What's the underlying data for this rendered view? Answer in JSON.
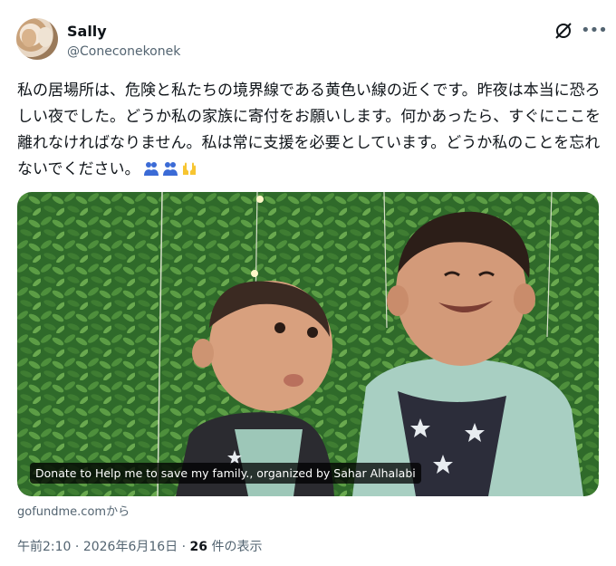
{
  "author": {
    "name": "Sally",
    "handle": "@Coneconekonek"
  },
  "post": {
    "text": "私の居場所は、危険と私たちの境界線である黄色い線の近くです。昨夜は本当に恐ろしい夜でした。どうか私の家族に寄付をお願いします。何かあったら、すぐにここを離れなければなりません。私は常に支援を必要としています。どうか私のことを忘れないでください。",
    "emojis": [
      "people-hugging-emoji",
      "people-hugging-emoji",
      "open-hands-emoji"
    ]
  },
  "link_card": {
    "caption": "Donate to Help me to save my family., organized by Sahar Alhalabi",
    "source": "gofundme.comから"
  },
  "meta": {
    "time": "午前2:10",
    "separator1": " · ",
    "date": "2026年6月16日",
    "separator2": " · ",
    "views_count": "26",
    "views_label": " 件の表示"
  },
  "icons": {
    "grok": "grok-icon",
    "more": "more-options-icon"
  },
  "colors": {
    "text": "#0f1419",
    "secondary": "#536471",
    "emoji_blue": "#3b6bd6",
    "emoji_yellow": "#f7c531"
  }
}
